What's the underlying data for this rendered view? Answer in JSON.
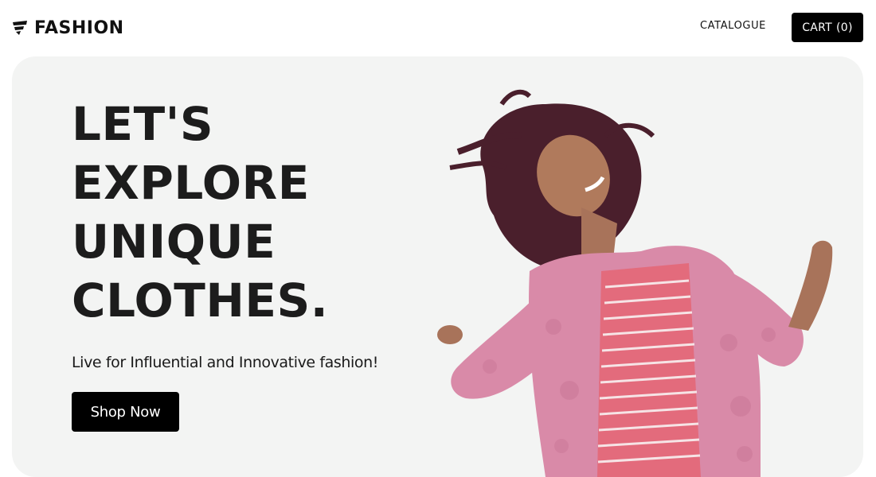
{
  "brand": {
    "name": "FASHION",
    "icon": "brand-logo-icon"
  },
  "nav": {
    "catalogue_label": "CATALOGUE",
    "cart_label": "CART",
    "cart_count": "(0)"
  },
  "hero": {
    "headline_lines": [
      "LET'S",
      "EXPLORE",
      "UNIQUE",
      "CLOTHES."
    ],
    "tagline": "Live for Influential and Innovative fashion!",
    "cta_label": "Shop Now",
    "image": "woman-in-pink-fur-coat-dancing"
  },
  "colors": {
    "hero_bg": "#f3f4f3",
    "button_bg": "#000000",
    "button_text": "#ffffff",
    "text": "#1c1c1c",
    "accent_pink": "#d98aa8"
  }
}
